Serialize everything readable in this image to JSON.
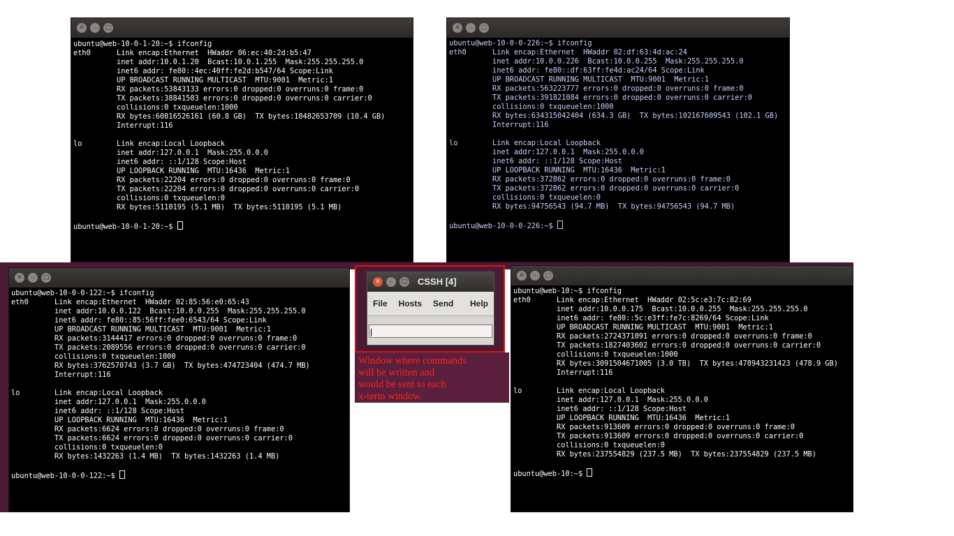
{
  "terminals": [
    {
      "id": "top-left",
      "lines": [
        "ubuntu@web-10-0-1-20:~$ ifconfig",
        "eth0      Link encap:Ethernet  HWaddr 06:ec:40:2d:b5:47",
        "          inet addr:10.0.1.20  Bcast:10.0.1.255  Mask:255.255.255.0",
        "          inet6 addr: fe80::4ec:40ff:fe2d:b547/64 Scope:Link",
        "          UP BROADCAST RUNNING MULTICAST  MTU:9001  Metric:1",
        "          RX packets:53843133 errors:0 dropped:0 overruns:0 frame:0",
        "          TX packets:38841503 errors:0 dropped:0 overruns:0 carrier:0",
        "          collisions:0 txqueuelen:1000",
        "          RX bytes:60816526161 (60.8 GB)  TX bytes:10482653709 (10.4 GB)",
        "          Interrupt:116",
        "",
        "lo        Link encap:Local Loopback",
        "          inet addr:127.0.0.1  Mask:255.0.0.0",
        "          inet6 addr: ::1/128 Scope:Host",
        "          UP LOOPBACK RUNNING  MTU:16436  Metric:1",
        "          RX packets:22204 errors:0 dropped:0 overruns:0 frame:0",
        "          TX packets:22204 errors:0 dropped:0 overruns:0 carrier:0",
        "          collisions:0 txqueuelen:0",
        "          RX bytes:5110195 (5.1 MB)  TX bytes:5110195 (5.1 MB)",
        ""
      ],
      "prompt": "ubuntu@web-10-0-1-20:~$ "
    },
    {
      "id": "top-right",
      "lines": [
        "ubuntu@web-10-0-0-226:~$ ifconfig",
        "eth0      Link encap:Ethernet  HWaddr 02:df:63:4d:ac:24",
        "          inet addr:10.0.0.226  Bcast:10.0.0.255  Mask:255.255.255.0",
        "          inet6 addr: fe80::df:63ff:fe4d:ac24/64 Scope:Link",
        "          UP BROADCAST RUNNING MULTICAST  MTU:9001  Metric:1",
        "          RX packets:563223777 errors:0 dropped:0 overruns:0 frame:0",
        "          TX packets:391821084 errors:0 dropped:0 overruns:0 carrier:0",
        "          collisions:0 txqueuelen:1000",
        "          RX bytes:634315042404 (634.3 GB)  TX bytes:102167609543 (102.1 GB)",
        "          Interrupt:116",
        "",
        "lo        Link encap:Local Loopback",
        "          inet addr:127.0.0.1  Mask:255.0.0.0",
        "          inet6 addr: ::1/128 Scope:Host",
        "          UP LOOPBACK RUNNING  MTU:16436  Metric:1",
        "          RX packets:372862 errors:0 dropped:0 overruns:0 frame:0",
        "          TX packets:372862 errors:0 dropped:0 overruns:0 carrier:0",
        "          collisions:0 txqueuelen:0",
        "          RX bytes:94756543 (94.7 MB)  TX bytes:94756543 (94.7 MB)",
        ""
      ],
      "prompt": "ubuntu@web-10-0-0-226:~$ "
    },
    {
      "id": "bottom-left",
      "lines": [
        "ubuntu@web-10-0-0-122:~$ ifconfig",
        "eth0      Link encap:Ethernet  HWaddr 02:85:56:e0:65:43",
        "          inet addr:10.0.0.122  Bcast:10.0.0.255  Mask:255.255.255.0",
        "          inet6 addr: fe80::85:56ff:fee0:6543/64 Scope:Link",
        "          UP BROADCAST RUNNING MULTICAST  MTU:9001  Metric:1",
        "          RX packets:3144417 errors:0 dropped:0 overruns:0 frame:0",
        "          TX packets:2089556 errors:0 dropped:0 overruns:0 carrier:0",
        "          collisions:0 txqueuelen:1000",
        "          RX bytes:3762570743 (3.7 GB)  TX bytes:474723404 (474.7 MB)",
        "          Interrupt:116",
        "",
        "lo        Link encap:Local Loopback",
        "          inet addr:127.0.0.1  Mask:255.0.0.0",
        "          inet6 addr: ::1/128 Scope:Host",
        "          UP LOOPBACK RUNNING  MTU:16436  Metric:1",
        "          RX packets:6624 errors:0 dropped:0 overruns:0 frame:0",
        "          TX packets:6624 errors:0 dropped:0 overruns:0 carrier:0",
        "          collisions:0 txqueuelen:0",
        "          RX bytes:1432263 (1.4 MB)  TX bytes:1432263 (1.4 MB)",
        ""
      ],
      "prompt": "ubuntu@web-10-0-0-122:~$ "
    },
    {
      "id": "bottom-right",
      "lines": [
        "ubuntu@web-10:~$ ifconfig",
        "eth0      Link encap:Ethernet  HWaddr 02:5c:e3:7c:82:69",
        "          inet addr:10.0.0.175  Bcast:10.0.0.255  Mask:255.255.255.0",
        "          inet6 addr: fe80::5c:e3ff:fe7c:8269/64 Scope:Link",
        "          UP BROADCAST RUNNING MULTICAST  MTU:9001  Metric:1",
        "          RX packets:2724371091 errors:0 dropped:0 overruns:0 frame:0",
        "          TX packets:1827403602 errors:0 dropped:0 overruns:0 carrier:0",
        "          collisions:0 txqueuelen:1000",
        "          RX bytes:3091504671005 (3.0 TB)  TX bytes:478943231423 (478.9 GB)",
        "          Interrupt:116",
        "",
        "lo        Link encap:Local Loopback",
        "          inet addr:127.0.0.1  Mask:255.0.0.0",
        "          inet6 addr: ::1/128 Scope:Host",
        "          UP LOOPBACK RUNNING  MTU:16436  Metric:1",
        "          RX packets:913609 errors:0 dropped:0 overruns:0 frame:0",
        "          TX packets:913609 errors:0 dropped:0 overruns:0 carrier:0",
        "          collisions:0 txqueuelen:0",
        "          RX bytes:237554829 (237.5 MB)  TX bytes:237554829 (237.5 MB)",
        ""
      ],
      "prompt": "ubuntu@web-10:~$ "
    }
  ],
  "cssh": {
    "title": "CSSH [4]",
    "menu": [
      "File",
      "Hosts",
      "Send",
      "Help"
    ],
    "input_value": ""
  },
  "note": {
    "lines": [
      "Window where commands",
      "will be written and",
      "would be sent to each",
      "x-term window."
    ]
  },
  "colors": {
    "terminal_bg": "#000000",
    "terminal_fg": "#ffffff",
    "desktop_band": "#4a1a33",
    "annotation_red": "#ff2222",
    "highlight_border": "#e01010"
  }
}
